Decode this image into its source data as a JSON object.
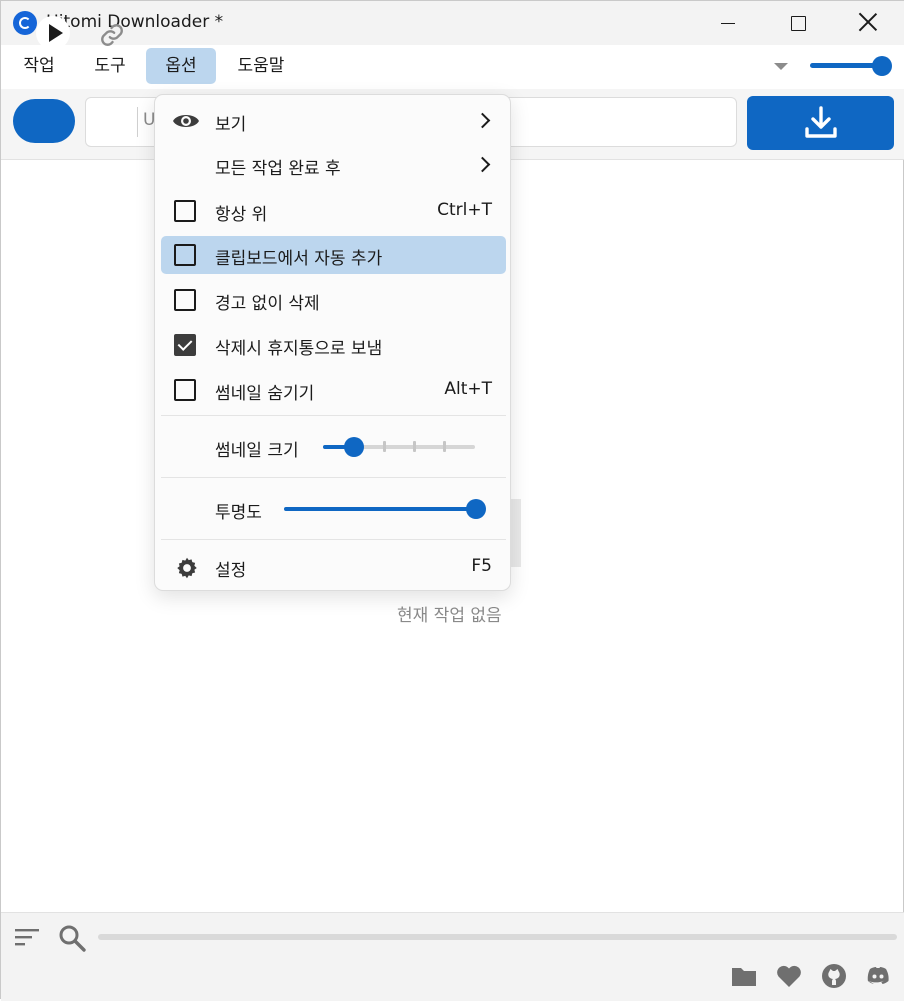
{
  "window": {
    "title": "Hitomi Downloader *"
  },
  "menubar": {
    "items": [
      {
        "label": "작업"
      },
      {
        "label": "도구"
      },
      {
        "label": "옵션"
      },
      {
        "label": "도움말"
      }
    ],
    "top_opacity_level": 1.0
  },
  "toolbar": {
    "url_placeholder": "U"
  },
  "empty_state": {
    "text": "현재 작업 없음"
  },
  "options_menu": {
    "items": [
      {
        "label": "보기",
        "icon": "eye-icon",
        "submenu": true
      },
      {
        "label": "모든 작업 완료 후",
        "submenu": true
      },
      {
        "label": "항상 위",
        "checked": false,
        "shortcut": "Ctrl+T"
      },
      {
        "label": "클립보드에서 자동 추가",
        "checked": false,
        "highlighted": true
      },
      {
        "label": "경고 없이 삭제",
        "checked": false
      },
      {
        "label": "삭제시 휴지통으로 보냄",
        "checked": true
      },
      {
        "label": "썸네일 숨기기",
        "checked": false,
        "shortcut": "Alt+T"
      }
    ],
    "thumbnail_size": {
      "label": "썸네일 크기",
      "level": 0.2
    },
    "opacity": {
      "label": "투명도",
      "level": 1.0
    },
    "settings": {
      "label": "설정",
      "icon": "gear-icon",
      "shortcut": "F5"
    }
  },
  "footer": {
    "icons": [
      "folder-icon",
      "heart-icon",
      "github-icon",
      "discord-icon"
    ]
  },
  "colors": {
    "accent": "#0f67c3",
    "highlight": "#bcd6ee"
  }
}
